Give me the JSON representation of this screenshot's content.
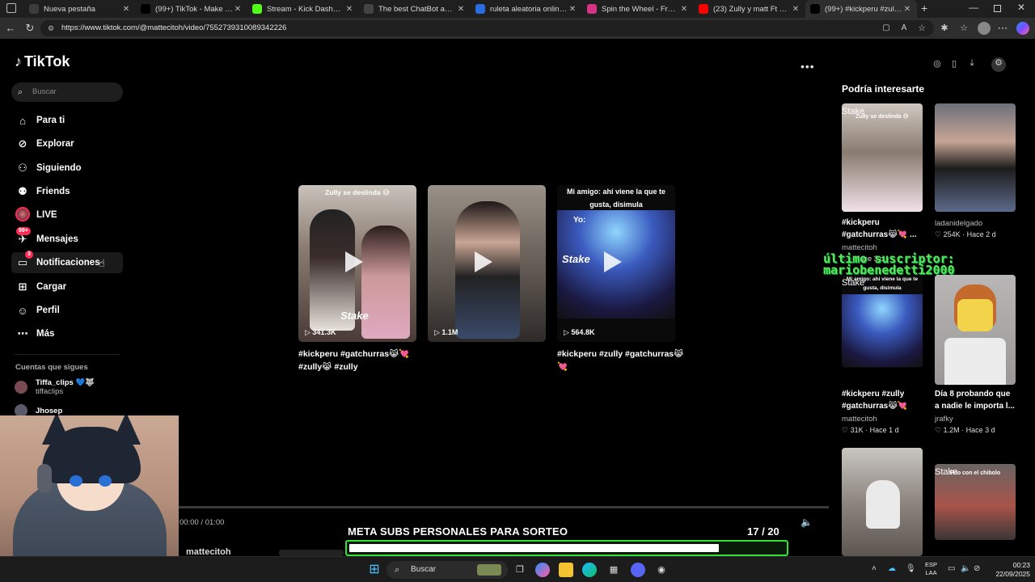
{
  "browser": {
    "tabs": [
      {
        "title": "Nueva pestaña",
        "icon": "window-icon",
        "color": "#3c3c3c"
      },
      {
        "title": "(99+) TikTok - Make Your Day",
        "icon": "tiktok-icon",
        "color": "#000000"
      },
      {
        "title": "Stream - Kick Dashboard",
        "icon": "kick-icon",
        "color": "#53fc18"
      },
      {
        "title": "The best ChatBot and Widgets",
        "icon": "chatbot-icon",
        "color": "#444444"
      },
      {
        "title": "ruleta aleatoria online - Búsqueda",
        "icon": "bing-search-icon",
        "color": "#2a6de0"
      },
      {
        "title": "Spin the Wheel - Free and Easy",
        "icon": "wheel-icon",
        "color": "#d63384"
      },
      {
        "title": "(23) Zully y matt Ft baile inc...",
        "icon": "youtube-icon",
        "color": "#ff0000"
      },
      {
        "title": "(99+) #kickperu #zully #gat...",
        "icon": "tiktok-icon",
        "color": "#000000"
      }
    ],
    "url": "https://www.tiktok.com/@mattecitoh/video/7552739310089342226"
  },
  "sidebar": {
    "logo": "TikTok",
    "search_placeholder": "Buscar",
    "items": [
      {
        "label": "Para ti",
        "icon": "home-icon"
      },
      {
        "label": "Explorar",
        "icon": "compass-icon"
      },
      {
        "label": "Siguiendo",
        "icon": "following-icon"
      },
      {
        "label": "Friends",
        "icon": "friends-icon"
      },
      {
        "label": "LIVE",
        "icon": "live-avatar-icon"
      },
      {
        "label": "Mensajes",
        "icon": "messages-icon",
        "badge": "99+"
      },
      {
        "label": "Notificaciones",
        "icon": "notifications-icon",
        "badge": "3"
      },
      {
        "label": "Cargar",
        "icon": "upload-icon"
      },
      {
        "label": "Perfil",
        "icon": "profile-icon"
      },
      {
        "label": "Más",
        "icon": "more-icon"
      }
    ],
    "following_title": "Cuentas que sigues",
    "following": [
      {
        "name": "Tiffa_clips 💙🐺",
        "username": "tiffaclips"
      },
      {
        "name": "Jhosep",
        "username": ""
      }
    ]
  },
  "videos": [
    {
      "caption": "Zully se deslinda 😅",
      "views": "341.3K",
      "desc": "#kickperu #gatchurras😹💘 #zully😹 #zully"
    },
    {
      "caption": "",
      "views": "1.1M",
      "desc": ""
    },
    {
      "caption": "Mi amigo: ahí viene la que te gusta, disimula",
      "views": "564.8K",
      "desc": "#kickperu #zully #gatchurras😹💘",
      "sub": "Yo:"
    }
  ],
  "watermark": "Stake",
  "recommended": {
    "title": "Podría interesarte",
    "items": [
      {
        "desc": "#kickperu #gatchurras😹💘 ...",
        "author": "mattecitoh",
        "likes": "",
        "age": "Hace 3 d",
        "caption": "Zully se deslinda 😅"
      },
      {
        "desc": "",
        "author": "ladanidelgado",
        "likes": "254K",
        "age": "Hace 2 d",
        "caption": ""
      },
      {
        "desc": "#kickperu #zully #gatchurras😹💘",
        "author": "mattecitoh",
        "likes": "31K",
        "age": "Hace 1 d",
        "caption": "Mi amigo: ahí viene la que te gusta, disimula"
      },
      {
        "desc": "Día 8 probando que a nadie le importa l...",
        "author": "jrafky",
        "likes": "1.2M",
        "age": "Hace 3 d",
        "caption": ""
      },
      {
        "desc": "",
        "author": "",
        "likes": "",
        "age": "",
        "caption": ""
      },
      {
        "desc": "",
        "author": "",
        "likes": "",
        "age": "",
        "caption": "Frío con el chibolo"
      }
    ]
  },
  "overlay": {
    "line1": "último suscriptor:",
    "line2": "mariobenedetti2000"
  },
  "player": {
    "time": "00:00 / 01:00",
    "author": "mattecitoh"
  },
  "goal": {
    "title": "META SUBS PERSONALES PARA SORTEO",
    "count": "17  / 20",
    "current": 17,
    "target": 20,
    "color": "#33e033"
  },
  "taskbar": {
    "search": "Buscar",
    "lang1": "ESP",
    "lang2": "LAA",
    "time": "00:23",
    "date": "22/09/2025"
  }
}
